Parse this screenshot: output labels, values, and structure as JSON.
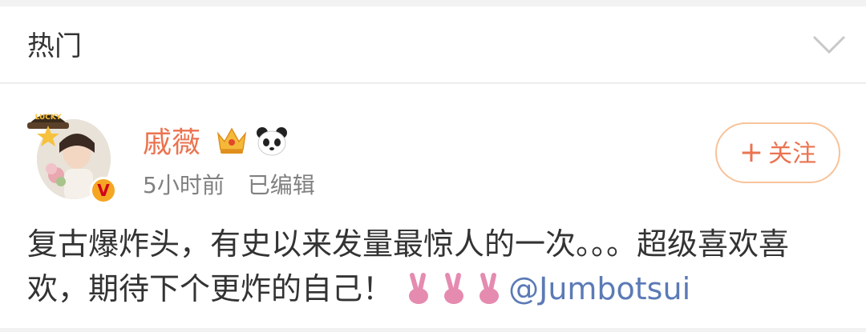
{
  "section": {
    "title": "热门",
    "chevron_icon": "chevron-down-icon"
  },
  "post": {
    "avatar_badge_text": "LUCKY",
    "verified_mark": "V",
    "username": "戚薇",
    "badges": [
      "crown-icon",
      "panda-icon"
    ],
    "time": "5小时前",
    "edited": "已编辑",
    "follow_label": "关注",
    "follow_plus": "+",
    "text_main": "复古爆炸头，有史以来发量最惊人的一次。。。超级喜欢喜欢，期待下个更炸的自己！",
    "peace_emojis": [
      "peace-hand-icon",
      "peace-hand-icon",
      "peace-hand-icon"
    ],
    "mention": "@Jumbotsui"
  },
  "colors": {
    "accent": "#eb7350",
    "link": "#5b7ab6",
    "text": "#333333",
    "meta": "#808080",
    "follow_border": "#f7c39a"
  }
}
